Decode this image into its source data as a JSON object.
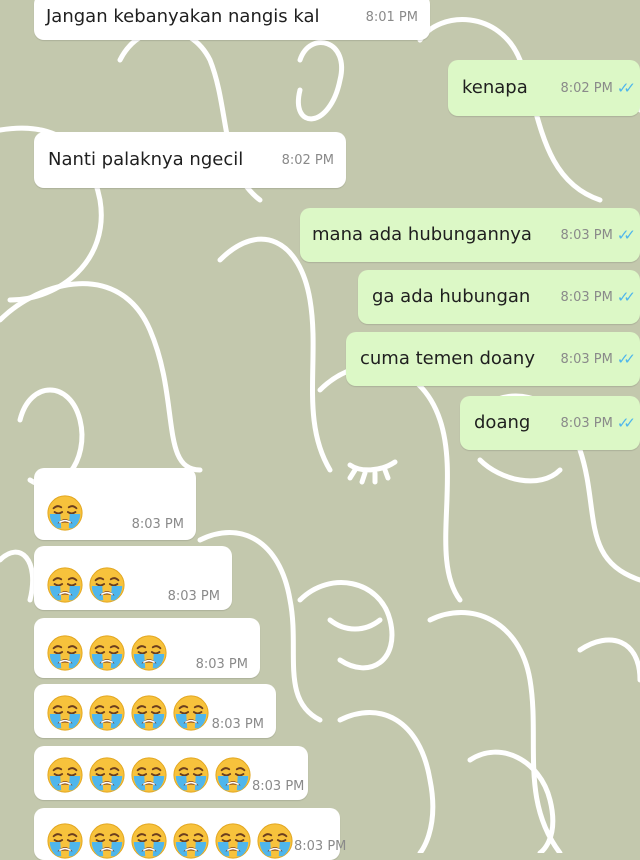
{
  "chat": {
    "messages": [
      {
        "text": "Jangan kebanyakan nangis kal",
        "time": "8:01 PM"
      },
      {
        "text": "kenapa",
        "time": "8:02 PM"
      },
      {
        "text": "Nanti palaknya ngecil",
        "time": "8:02 PM"
      },
      {
        "text": "mana ada hubungannya",
        "time": "8:03 PM"
      },
      {
        "text": "ga ada hubungan",
        "time": "8:03 PM"
      },
      {
        "text": "cuma temen doany",
        "time": "8:03 PM"
      },
      {
        "text": "doang",
        "time": "8:03 PM"
      },
      {
        "emoji_count": 1,
        "time": "8:03 PM"
      },
      {
        "emoji_count": 2,
        "time": "8:03 PM"
      },
      {
        "emoji_count": 3,
        "time": "8:03 PM"
      },
      {
        "emoji_count": 4,
        "time": "8:03 PM"
      },
      {
        "emoji_count": 5,
        "time": "8:03 PM"
      },
      {
        "emoji_count": 6,
        "time": "8:03 PM"
      }
    ],
    "emoji_name": "loudly-crying-face",
    "read_receipt": "double-check",
    "colors": {
      "background": "#c3c8ad",
      "incoming_bubble": "#ffffff",
      "outgoing_bubble": "#dcf8c6",
      "read_tick": "#4fb6ec"
    }
  }
}
